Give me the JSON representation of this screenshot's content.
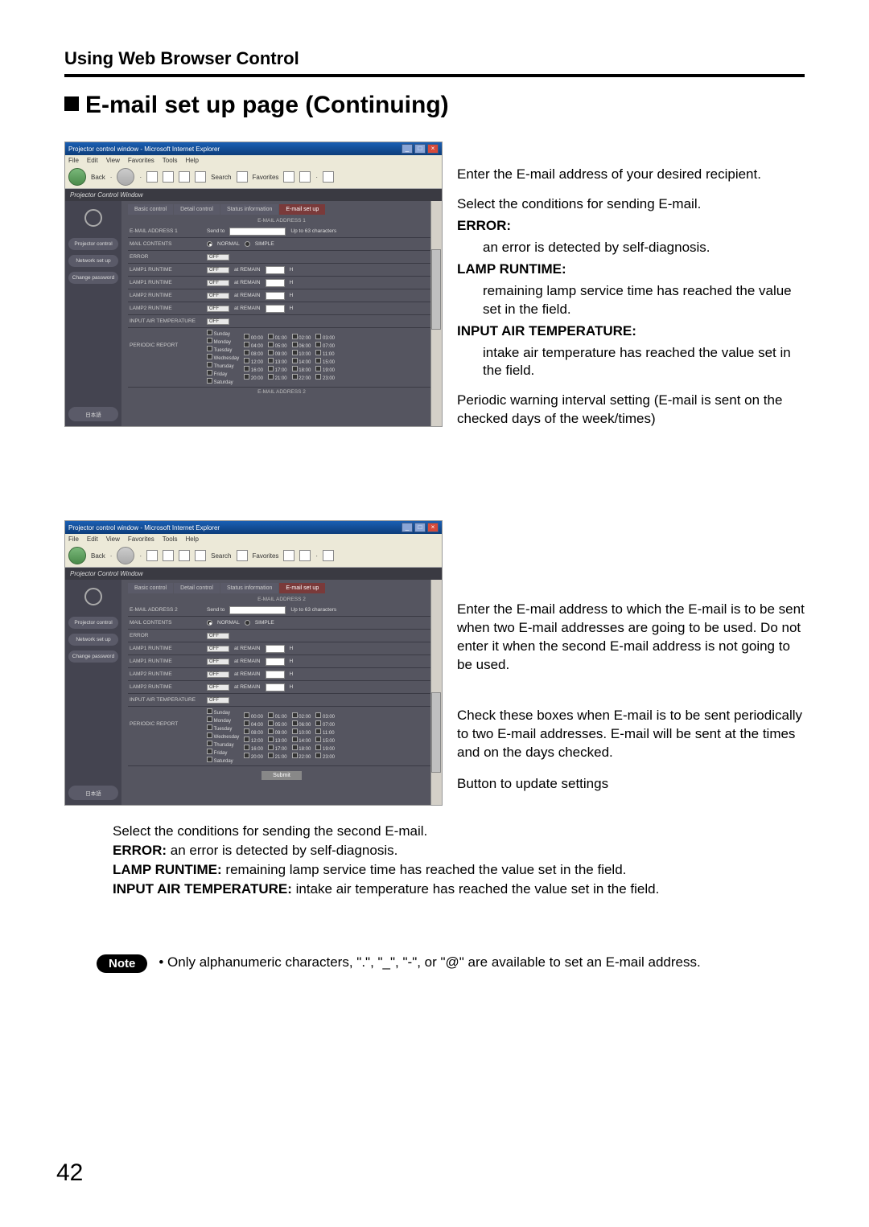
{
  "section_header": "Using Web Browser Control",
  "page_title": "E-mail set up page (Continuing)",
  "page_number": "42",
  "browser": {
    "title": "Projector control window - Microsoft Internet Explorer",
    "menus": [
      "File",
      "Edit",
      "View",
      "Favorites",
      "Tools",
      "Help"
    ],
    "back": "Back",
    "search": "Search",
    "favorites": "Favorites",
    "header": "Projector Control Window"
  },
  "sidebar": {
    "projector": "Projector control",
    "network": "Network set up",
    "change_pw": "Change password",
    "japanese": "日本語"
  },
  "tabs": [
    "Basic control",
    "Detail control",
    "Status information",
    "E-mail set up"
  ],
  "section1": {
    "label": "E-MAIL ADDRESS 1",
    "address_label": "E-MAIL ADDRESS 1",
    "send_to": "Send to",
    "up_to": "Up to 63 characters",
    "mail_contents": "MAIL CONTENTS",
    "normal": "NORMAL",
    "simple": "SIMPLE",
    "error": "ERROR",
    "lamp1": "LAMP1 RUNTIME",
    "lamp1b": "LAMP1 RUNTIME",
    "lamp2": "LAMP2 RUNTIME",
    "lamp2b": "LAMP2 RUNTIME",
    "remain": "at REMAIN",
    "h": "H",
    "air_temp": "INPUT AIR TEMPERATURE",
    "periodic": "PERIODIC REPORT",
    "off": "OFF",
    "days": [
      "Sunday",
      "Monday",
      "Tuesday",
      "Wednesday",
      "Thursday",
      "Friday",
      "Saturday"
    ],
    "times": [
      "00:00",
      "01:00",
      "02:00",
      "03:00",
      "04:00",
      "05:00",
      "06:00",
      "07:00",
      "08:00",
      "09:00",
      "10:00",
      "11:00",
      "12:00",
      "13:00",
      "14:00",
      "15:00",
      "16:00",
      "17:00",
      "18:00",
      "19:00",
      "20:00",
      "21:00",
      "22:00",
      "23:00"
    ],
    "footer": "E-MAIL ADDRESS 2"
  },
  "section2": {
    "label": "E-MAIL ADDRESS 2",
    "address_label": "E-MAIL ADDRESS 2",
    "submit": "Submit"
  },
  "ann1": {
    "a1": "Enter the E-mail address of your desired recipient.",
    "a2_lead": "Select the conditions for sending E-mail.",
    "error_label": "ERROR:",
    "error_text": "an error is detected by self-diagnosis.",
    "lamp_label": "LAMP RUNTIME:",
    "lamp_text": "remaining lamp service time has reached the value set in the field.",
    "air_label": "INPUT AIR TEMPERATURE:",
    "air_text": "intake air temperature has reached the value set in the field.",
    "a3": "Periodic warning interval setting (E-mail is sent on the checked days of the week/times)"
  },
  "ann2": {
    "a1": "Enter the E-mail address to which the E-mail is to be sent when two E-mail addresses are going to be used. Do not enter it when the second E-mail address is not going to be used.",
    "a2": "Check these boxes when E-mail is to be sent periodically to two E-mail addresses. E-mail will be sent at the times and on the days checked.",
    "a3": "Button to update settings"
  },
  "bottom": {
    "line1": "Select the conditions for sending the second E-mail.",
    "error_label": "ERROR:",
    "error_text": " an error is detected by self-diagnosis.",
    "lamp_label": "LAMP RUNTIME:",
    "lamp_text": " remaining lamp service time has reached the value set in the field.",
    "air_label": "INPUT AIR TEMPERATURE:",
    "air_text": " intake air temperature has reached the value set in the field."
  },
  "note": {
    "label": "Note",
    "text": "• Only alphanumeric characters, \".\", \"_\", \"-\", or \"@\" are available to set an E-mail address."
  }
}
